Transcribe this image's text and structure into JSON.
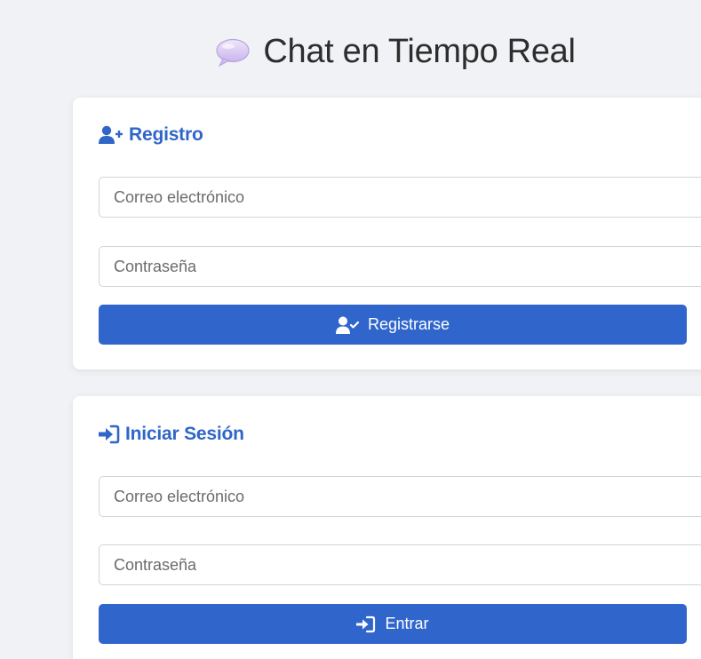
{
  "header": {
    "title": "Chat en Tiempo Real",
    "icon": "speech-bubble-icon"
  },
  "register": {
    "title": "Registro",
    "icon": "user-plus-icon",
    "email_placeholder": "Correo electrónico",
    "password_placeholder": "Contraseña",
    "submit_label": "Registrarse",
    "submit_icon": "user-check-icon"
  },
  "login": {
    "title": "Iniciar Sesión",
    "icon": "sign-in-icon",
    "email_placeholder": "Correo electrónico",
    "password_placeholder": "Contraseña",
    "submit_label": "Entrar",
    "submit_icon": "sign-in-icon"
  },
  "colors": {
    "accent": "#3066cc",
    "heading": "#2f66c8",
    "background": "#f0f2f5",
    "card": "#ffffff"
  }
}
